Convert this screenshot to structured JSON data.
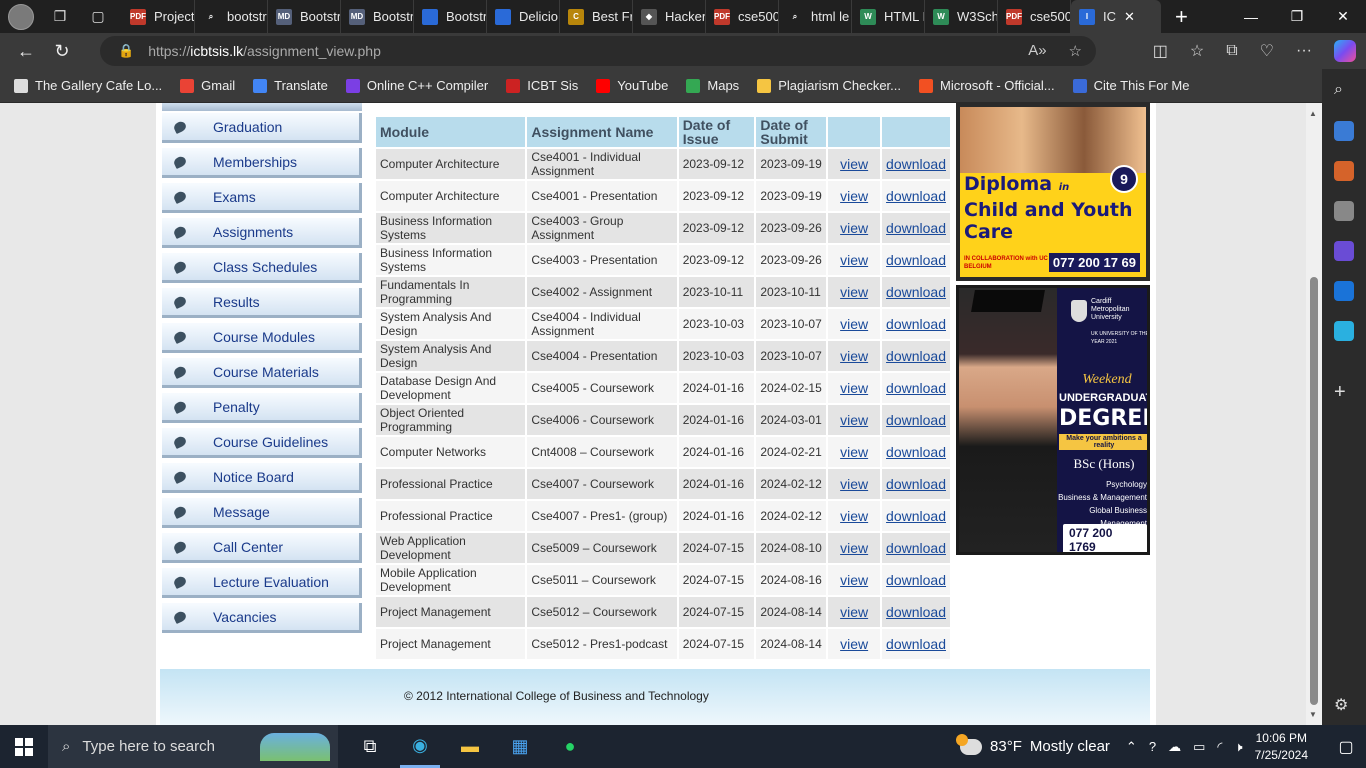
{
  "browser": {
    "tabs": [
      {
        "label": "Project",
        "fav": "#c0392b",
        "fav_text": "PDF"
      },
      {
        "label": "bootstr",
        "fav": "#202020",
        "fav_text": "⌕"
      },
      {
        "label": "Bootstr",
        "fav": "#55607a",
        "fav_text": "MD"
      },
      {
        "label": "Bootstr",
        "fav": "#55607a",
        "fav_text": "MD"
      },
      {
        "label": "Bootstr",
        "fav": "#2a6ad8",
        "fav_text": ""
      },
      {
        "label": "Delicio",
        "fav": "#2a6ad8",
        "fav_text": ""
      },
      {
        "label": "Best Fr",
        "fav": "#b8860b",
        "fav_text": "C"
      },
      {
        "label": "Hacker",
        "fav": "#555555",
        "fav_text": "◆"
      },
      {
        "label": "cse500",
        "fav": "#c0392b",
        "fav_text": "PDF"
      },
      {
        "label": "html le",
        "fav": "#202020",
        "fav_text": "⌕"
      },
      {
        "label": "HTML I",
        "fav": "#2e8b57",
        "fav_text": "W"
      },
      {
        "label": "W3Sch",
        "fav": "#2e8b57",
        "fav_text": "W"
      },
      {
        "label": "cse500",
        "fav": "#c0392b",
        "fav_text": "PDF"
      },
      {
        "label": "IC",
        "fav": "#2a6ad8",
        "fav_text": "I"
      }
    ],
    "url_prefix": "https://",
    "url_host": "icbtsis.lk",
    "url_path": "/assignment_view.php",
    "bookmarks": [
      {
        "label": "The Gallery Cafe Lo...",
        "color": "#dddddd"
      },
      {
        "label": "Gmail",
        "color": "#ea4335"
      },
      {
        "label": "Translate",
        "color": "#4285f4"
      },
      {
        "label": "Online C++ Compiler",
        "color": "#7b3fe4"
      },
      {
        "label": "ICBT Sis",
        "color": "#cc2222"
      },
      {
        "label": "YouTube",
        "color": "#ff0000"
      },
      {
        "label": "Maps",
        "color": "#34a853"
      },
      {
        "label": "Plagiarism Checker...",
        "color": "#f5c542"
      },
      {
        "label": "Microsoft - Official...",
        "color": "#f25022"
      },
      {
        "label": "Cite This For Me",
        "color": "#3a6ad8"
      }
    ]
  },
  "sidebar": {
    "items": [
      "Graduation",
      "Memberships",
      "Exams",
      "Assignments",
      "Class Schedules",
      "Results",
      "Course Modules",
      "Course Materials",
      "Penalty",
      "Course Guidelines",
      "Notice Board",
      "Message",
      "Call Center",
      "Lecture Evaluation",
      "Vacancies"
    ]
  },
  "table": {
    "headers": [
      "Module",
      "Assignment Name",
      "Date of Issue",
      "Date of Submit",
      "",
      ""
    ],
    "view_label": "view",
    "download_label": "download",
    "rows": [
      [
        "Computer Architecture",
        "Cse4001 - Individual Assignment",
        "2023-09-12",
        "2023-09-19"
      ],
      [
        "Computer Architecture",
        "Cse4001 - Presentation",
        "2023-09-12",
        "2023-09-19"
      ],
      [
        "Business Information Systems",
        "Cse4003 - Group Assignment",
        "2023-09-12",
        "2023-09-26"
      ],
      [
        "Business Information Systems",
        "Cse4003 - Presentation",
        "2023-09-12",
        "2023-09-26"
      ],
      [
        "Fundamentals In Programming",
        "Cse4002 - Assignment",
        "2023-10-11",
        "2023-10-11"
      ],
      [
        "System Analysis And Design",
        "Cse4004 - Individual Assignment",
        "2023-10-03",
        "2023-10-07"
      ],
      [
        "System Analysis And Design",
        "Cse4004 - Presentation",
        "2023-10-03",
        "2023-10-07"
      ],
      [
        "Database Design And Development",
        "Cse4005 - Coursework",
        "2024-01-16",
        "2024-02-15"
      ],
      [
        "Object Oriented Programming",
        "Cse4006 - Coursework",
        "2024-01-16",
        "2024-03-01"
      ],
      [
        "Computer Networks",
        "Cnt4008 – Coursework",
        "2024-01-16",
        "2024-02-21"
      ],
      [
        "Professional Practice",
        "Cse4007 - Coursework",
        "2024-01-16",
        "2024-02-12"
      ],
      [
        "Professional Practice",
        "Cse4007 - Pres1- (group)",
        "2024-01-16",
        "2024-02-12"
      ],
      [
        "Web Application Development",
        "Cse5009 – Coursework",
        "2024-07-15",
        "2024-08-10"
      ],
      [
        "Mobile Application Development",
        "Cse5011 – Coursework",
        "2024-07-15",
        "2024-08-16"
      ],
      [
        "Project Management",
        "Cse5012 – Coursework",
        "2024-07-15",
        "2024-08-14"
      ],
      [
        "Project Management",
        "Cse5012 - Pres1-podcast",
        "2024-07-15",
        "2024-08-14"
      ]
    ]
  },
  "ads": {
    "ad1": {
      "title_line1": "Diploma",
      "title_in": "in",
      "title_line2": "Child and Youth Care",
      "badge": "9",
      "collab": "IN COLLABORATION with UC LEUVEN LIMBURG (UCLL) | BELGIUM",
      "phone": "077 200 17 69"
    },
    "ad2": {
      "university": "Cardiff Metropolitan University",
      "uk_uni": "UK UNIVERSITY OF THE YEAR 2021",
      "weekend": "Weekend",
      "undergrad": "UNDERGRADUATE",
      "degrees": "DEGREES",
      "ambition": "Make your ambitions a reality",
      "bsc": "BSc (Hons)",
      "programs": [
        "Psychology",
        "Business & Management",
        "Global Business Management"
      ],
      "phone": "077 200 1769"
    }
  },
  "footer": {
    "text": "© 2012 International College of Business and Technology"
  },
  "taskbar": {
    "search_placeholder": "Type here to search",
    "weather_temp": "83°F",
    "weather_desc": "Mostly clear",
    "time": "10:06 PM",
    "date": "7/25/2024"
  }
}
